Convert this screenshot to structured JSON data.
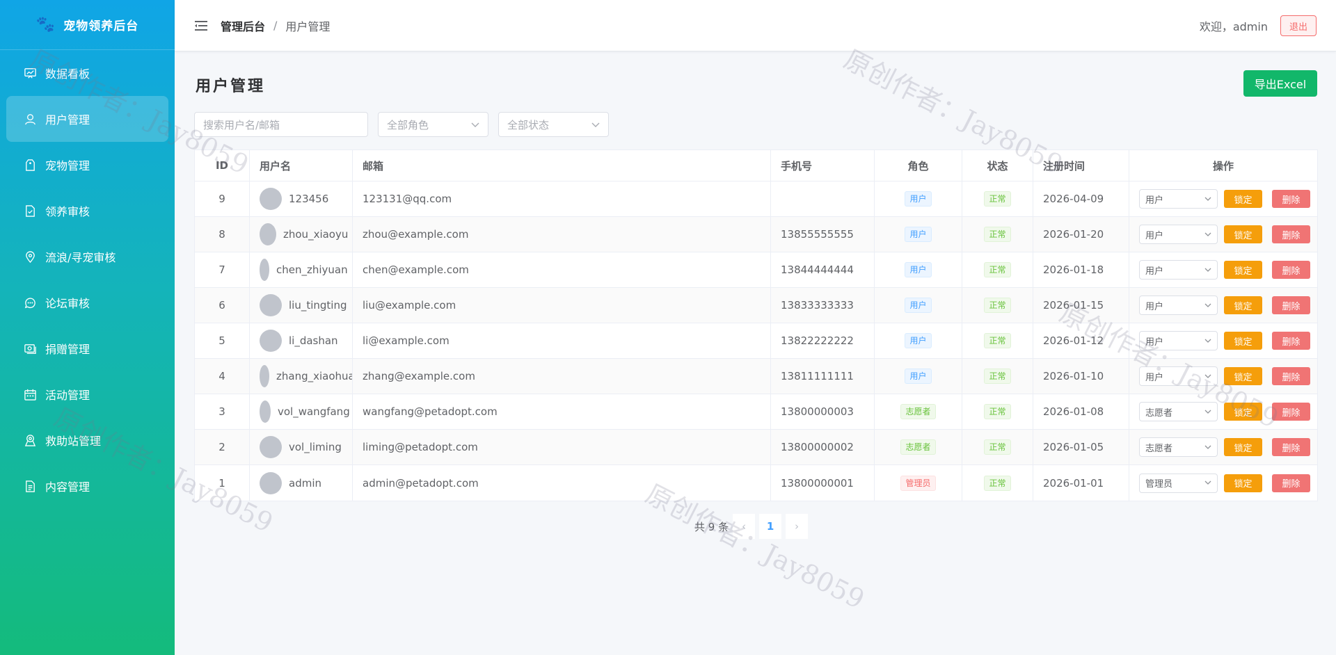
{
  "app": {
    "title": "宠物领养后台"
  },
  "sidebar": {
    "items": [
      {
        "label": "数据看板",
        "icon": "dashboard-icon"
      },
      {
        "label": "用户管理",
        "icon": "user-icon",
        "active": true
      },
      {
        "label": "宠物管理",
        "icon": "tag-icon"
      },
      {
        "label": "领养审核",
        "icon": "document-check-icon"
      },
      {
        "label": "流浪/寻宠审核",
        "icon": "location-icon"
      },
      {
        "label": "论坛审核",
        "icon": "chat-icon"
      },
      {
        "label": "捐赠管理",
        "icon": "money-icon"
      },
      {
        "label": "活动管理",
        "icon": "calendar-icon"
      },
      {
        "label": "救助站管理",
        "icon": "map-pin-icon"
      },
      {
        "label": "内容管理",
        "icon": "file-icon"
      }
    ]
  },
  "header": {
    "breadcrumb_root": "管理后台",
    "breadcrumb_sep": "/",
    "breadcrumb_current": "用户管理",
    "welcome": "欢迎，admin",
    "logout": "退出"
  },
  "page": {
    "title": "用户管理",
    "export_label": "导出Excel",
    "search_placeholder": "搜索用户名/邮箱",
    "role_filter": "全部角色",
    "status_filter": "全部状态"
  },
  "table": {
    "columns": [
      "ID",
      "用户名",
      "邮箱",
      "手机号",
      "角色",
      "状态",
      "注册时间",
      "操作"
    ],
    "rows": [
      {
        "id": "9",
        "username": "123456",
        "email": "123131@qq.com",
        "phone": "",
        "role": "用户",
        "role_type": "user",
        "status": "正常",
        "date": "2026-04-09",
        "role_select": "用户"
      },
      {
        "id": "8",
        "username": "zhou_xiaoyu",
        "email": "zhou@example.com",
        "phone": "13855555555",
        "role": "用户",
        "role_type": "user",
        "status": "正常",
        "date": "2026-01-20",
        "role_select": "用户"
      },
      {
        "id": "7",
        "username": "chen_zhiyuan",
        "email": "chen@example.com",
        "phone": "13844444444",
        "role": "用户",
        "role_type": "user",
        "status": "正常",
        "date": "2026-01-18",
        "role_select": "用户"
      },
      {
        "id": "6",
        "username": "liu_tingting",
        "email": "liu@example.com",
        "phone": "13833333333",
        "role": "用户",
        "role_type": "user",
        "status": "正常",
        "date": "2026-01-15",
        "role_select": "用户"
      },
      {
        "id": "5",
        "username": "li_dashan",
        "email": "li@example.com",
        "phone": "13822222222",
        "role": "用户",
        "role_type": "user",
        "status": "正常",
        "date": "2026-01-12",
        "role_select": "用户"
      },
      {
        "id": "4",
        "username": "zhang_xiaohua",
        "email": "zhang@example.com",
        "phone": "13811111111",
        "role": "用户",
        "role_type": "user",
        "status": "正常",
        "date": "2026-01-10",
        "role_select": "用户"
      },
      {
        "id": "3",
        "username": "vol_wangfang",
        "email": "wangfang@petadopt.com",
        "phone": "13800000003",
        "role": "志愿者",
        "role_type": "vol",
        "status": "正常",
        "date": "2026-01-08",
        "role_select": "志愿者"
      },
      {
        "id": "2",
        "username": "vol_liming",
        "email": "liming@petadopt.com",
        "phone": "13800000002",
        "role": "志愿者",
        "role_type": "vol",
        "status": "正常",
        "date": "2026-01-05",
        "role_select": "志愿者"
      },
      {
        "id": "1",
        "username": "admin",
        "email": "admin@petadopt.com",
        "phone": "13800000001",
        "role": "管理员",
        "role_type": "admin",
        "status": "正常",
        "date": "2026-01-01",
        "role_select": "管理员"
      }
    ],
    "lock_label": "锁定",
    "delete_label": "删除"
  },
  "pagination": {
    "total": "共 9 条",
    "current": "1"
  },
  "watermark": "原创作者：Jay8059",
  "colors": {
    "accent": "#409eff",
    "export": "#12b76a",
    "lock": "#f59e0b",
    "delete": "#f07474"
  }
}
